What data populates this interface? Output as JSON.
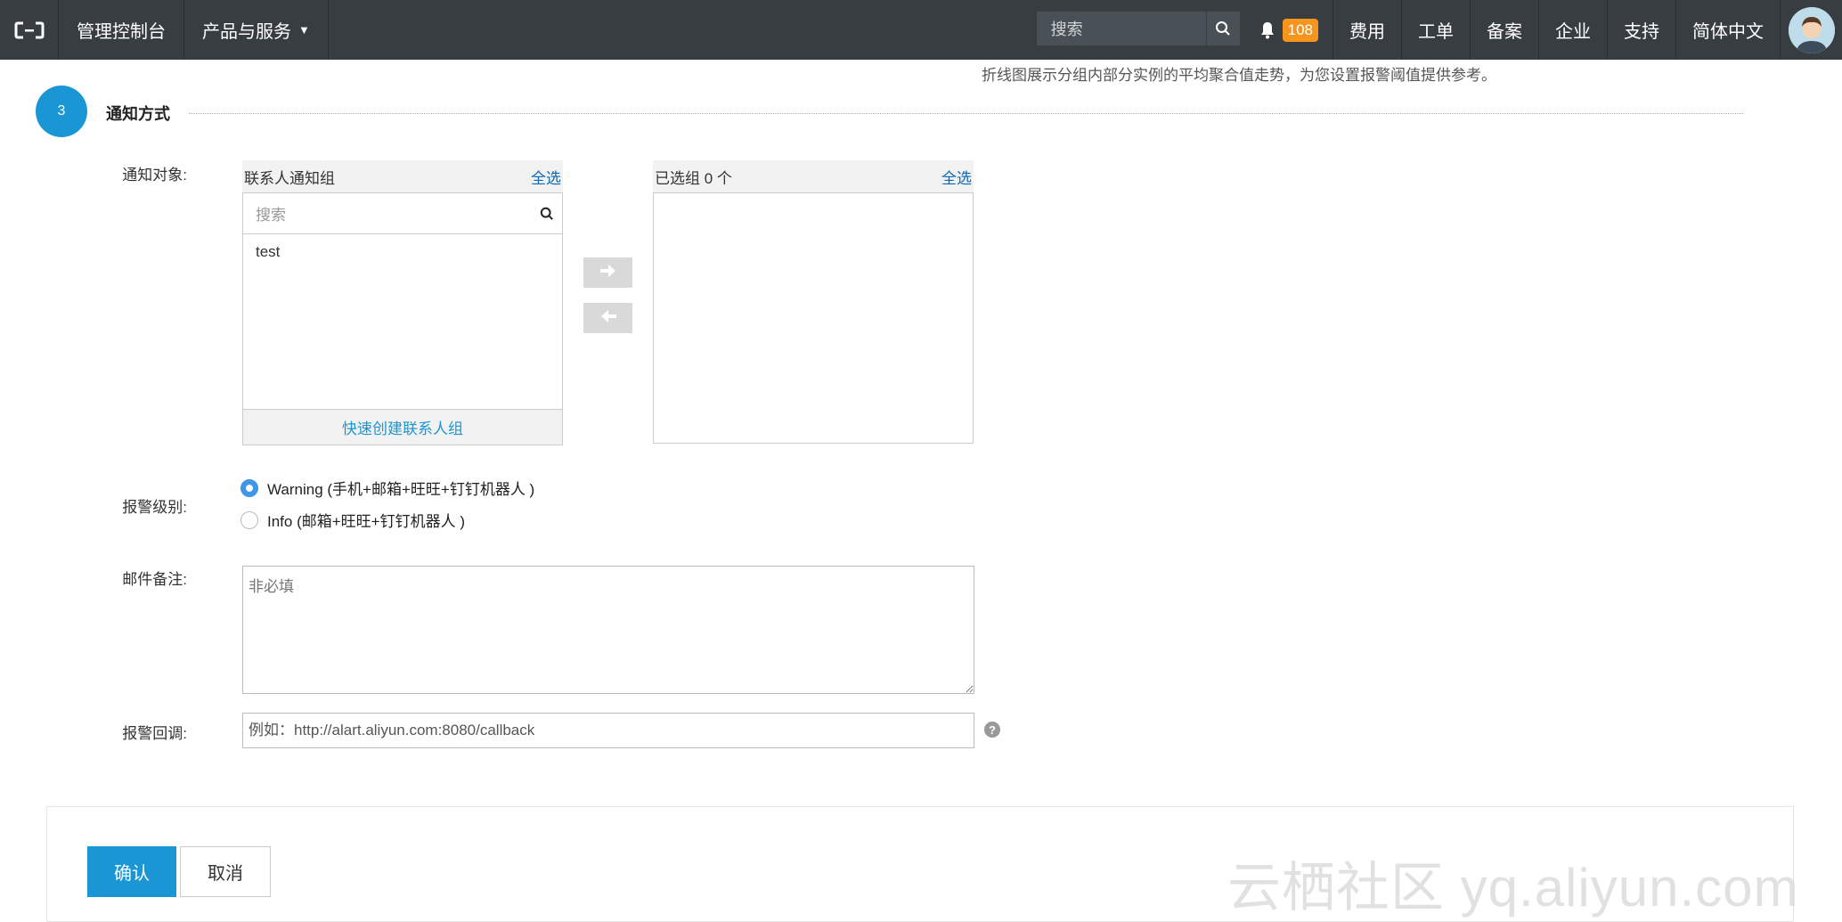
{
  "topbar": {
    "console_label": "管理控制台",
    "products_label": "产品与服务",
    "search_placeholder": "搜索",
    "notification_count": "108",
    "nav": [
      "费用",
      "工单",
      "备案",
      "企业",
      "支持",
      "简体中文"
    ]
  },
  "hint": "折线图展示分组内部分实例的平均聚合值走势，为您设置报警阈值提供参考。",
  "step": {
    "number": "3",
    "title": "通知方式"
  },
  "notify_target": {
    "label": "通知对象:",
    "left_title": "联系人通知组",
    "select_all": "全选",
    "search_placeholder": "搜索",
    "items": [
      "test"
    ],
    "quick_create": "快速创建联系人组",
    "right_title": "已选组 0 个"
  },
  "alarm_level": {
    "label": "报警级别:",
    "options": [
      {
        "label": "Warning (手机+邮箱+旺旺+钉钉机器人 )",
        "checked": true
      },
      {
        "label": "Info (邮箱+旺旺+钉钉机器人 )",
        "checked": false
      }
    ]
  },
  "email_note": {
    "label": "邮件备注:",
    "placeholder": "非必填"
  },
  "callback": {
    "label": "报警回调:",
    "placeholder": "例如：http://alart.aliyun.com:8080/callback",
    "help": "?"
  },
  "footer": {
    "confirm": "确认",
    "cancel": "取消"
  },
  "watermark": "云栖社区 yq.aliyun.com"
}
